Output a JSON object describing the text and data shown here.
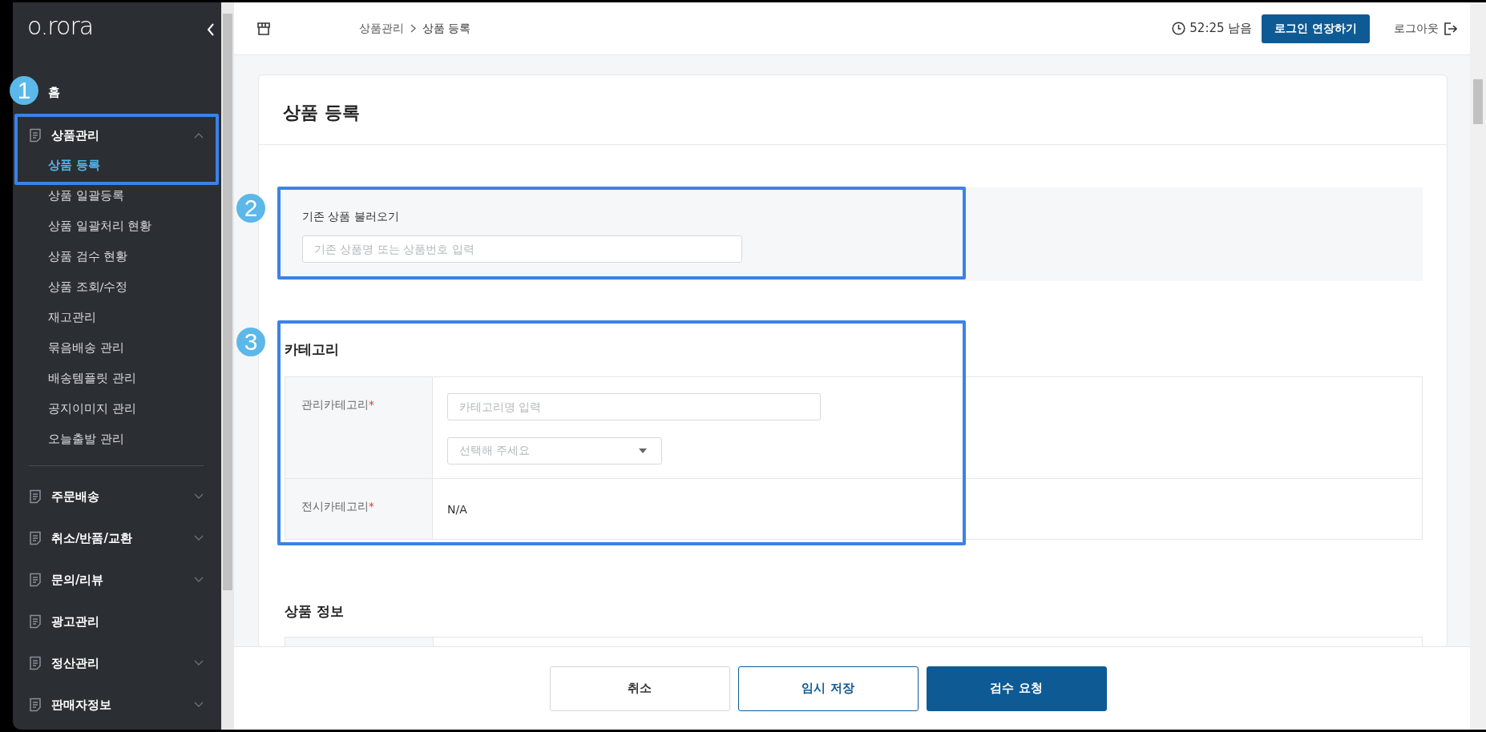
{
  "sidebar": {
    "logo": "o.rora",
    "items": [
      {
        "label": "홈",
        "kind": "link"
      },
      {
        "label": "상품관리",
        "kind": "group",
        "expanded": true,
        "children": [
          {
            "label": "상품 등록",
            "selected": true
          },
          {
            "label": "상품 일괄등록",
            "selected": false
          },
          {
            "label": "상품 일괄처리 현황",
            "selected": false
          },
          {
            "label": "상품 검수 현황",
            "selected": false
          },
          {
            "label": "상품 조회/수정",
            "selected": false
          },
          {
            "label": "재고관리",
            "selected": false
          },
          {
            "label": "묶음배송 관리",
            "selected": false
          },
          {
            "label": "배송템플릿 관리",
            "selected": false
          },
          {
            "label": "공지이미지 관리",
            "selected": false
          },
          {
            "label": "오늘출발 관리",
            "selected": false
          }
        ]
      },
      {
        "label": "주문배송",
        "kind": "group",
        "expanded": false
      },
      {
        "label": "취소/반품/교환",
        "kind": "group",
        "expanded": false
      },
      {
        "label": "문의/리뷰",
        "kind": "group",
        "expanded": false
      },
      {
        "label": "광고관리",
        "kind": "link"
      },
      {
        "label": "정산관리",
        "kind": "group",
        "expanded": false
      },
      {
        "label": "판매자정보",
        "kind": "group",
        "expanded": false
      }
    ]
  },
  "header": {
    "breadcrumb": [
      "상품관리",
      "상품 등록"
    ],
    "timer": "52:25 남음",
    "extend_button": "로그인 연장하기",
    "logout": "로그아웃"
  },
  "page": {
    "title": "상품 등록",
    "load_existing": {
      "label": "기존 상품 불러오기",
      "placeholder": "기존 상품명 또는 상품번호 입력"
    },
    "category": {
      "title": "카테고리",
      "rows": [
        {
          "label": "관리카테고리",
          "required_mark": "*",
          "kind": "picker",
          "search_placeholder": "카테고리명 입력",
          "select_placeholder": "선택해 주세요"
        },
        {
          "label": "전시카테고리",
          "required_mark": "*",
          "kind": "text",
          "value": "N/A"
        }
      ]
    },
    "product_info": {
      "title": "상품 정보"
    }
  },
  "footer": {
    "buttons": [
      {
        "label": "취소",
        "kind": "plain"
      },
      {
        "label": "임시 저장",
        "kind": "outline"
      },
      {
        "label": "검수 요청",
        "kind": "primary"
      }
    ]
  },
  "annotations": [
    {
      "number": "1"
    },
    {
      "number": "2"
    },
    {
      "number": "3"
    }
  ]
}
